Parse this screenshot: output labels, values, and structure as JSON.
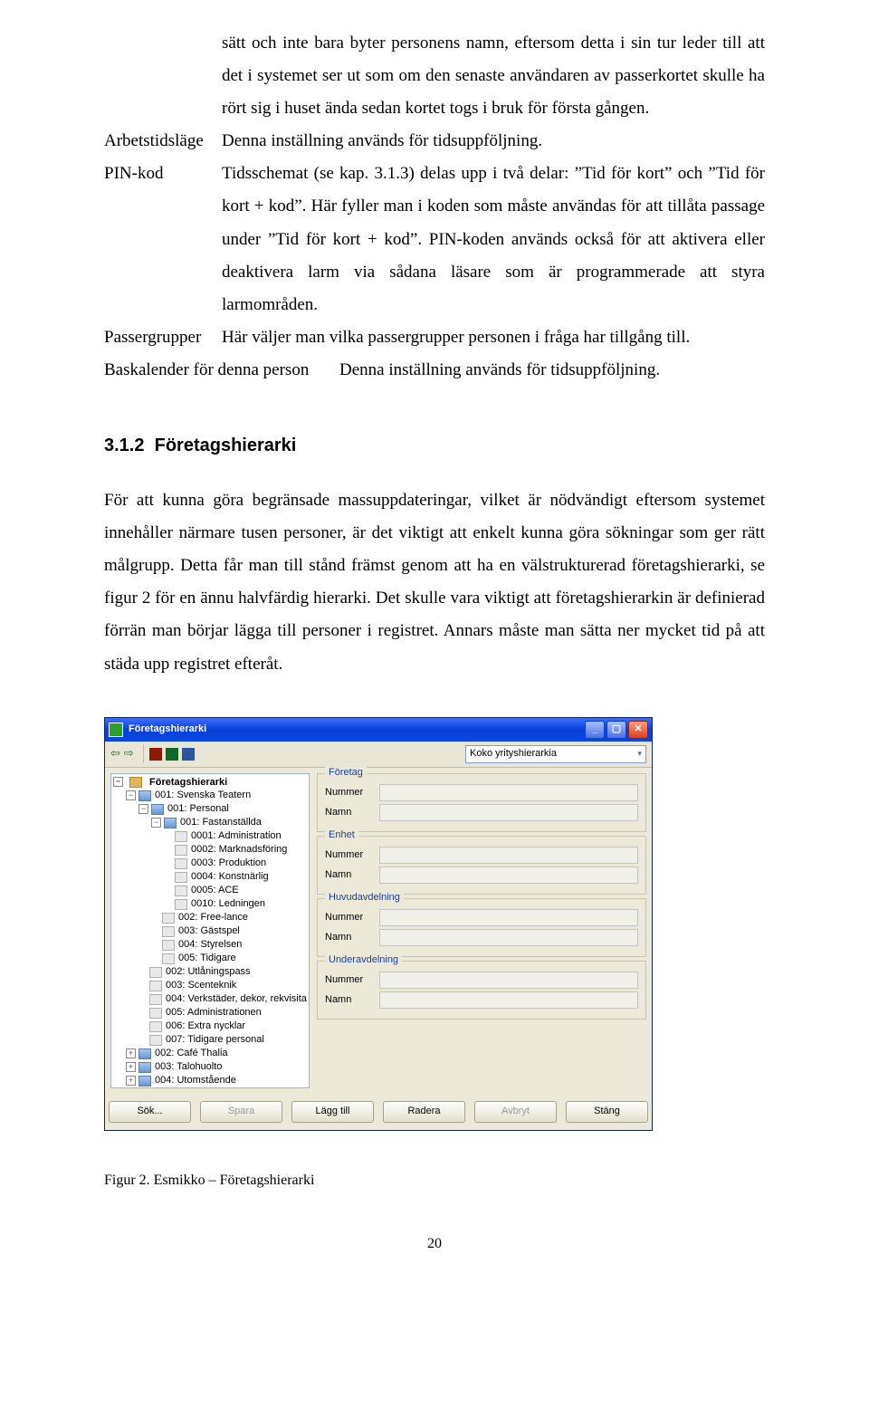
{
  "defs": {
    "intro_cont": "sätt och inte bara byter personens namn, eftersom detta i sin tur leder till att det i systemet ser ut som om den senaste användaren av passerkortet skulle ha rört sig i huset ända sedan kortet togs i bruk för första gången.",
    "arbetstidslage": {
      "term": "Arbetstidsläge",
      "text": "Denna inställning används för tidsuppföljning."
    },
    "pin": {
      "term": "PIN-kod",
      "text": "Tidsschemat (se kap. 3.1.3) delas upp i två delar: ”Tid för kort” och ”Tid för kort + kod”. Här fyller man i koden som måste användas för att tillåta passage under ”Tid för kort + kod”. PIN-koden används också för att aktivera eller deaktivera larm via sådana läsare som är programmerade att styra larmområden."
    },
    "passergrupper": {
      "term": "Passergrupper",
      "text": "Här väljer man vilka passergrupper personen i fråga har tillgång till."
    },
    "baskalender": {
      "term": "Baskalender för denna person",
      "text": "Denna inställning används för tidsuppföljning."
    }
  },
  "section": {
    "num": "3.1.2",
    "title": "Företagshierarki"
  },
  "body": "För att kunna göra begränsade massuppdateringar, vilket är nödvändigt eftersom systemet innehåller närmare tusen personer, är det viktigt att enkelt kunna göra sökningar som ger rätt målgrupp. Detta får man till stånd främst genom att ha en välstrukturerad företagshierarki, se figur 2 för en ännu halvfärdig hierarki. Det skulle vara viktigt att företagshierarkin är definierad förrän man börjar lägga till personer i registret. Annars måste man sätta ner mycket tid på att städa upp registret efteråt.",
  "win": {
    "title": "Företagshierarki",
    "combo": "Koko yrityshierarkia",
    "root": "Företagshierarki",
    "tree": [
      {
        "d": 1,
        "t": "−",
        "i": "f",
        "l": "001: Svenska Teatern"
      },
      {
        "d": 2,
        "t": "−",
        "i": "f",
        "l": "001: Personal"
      },
      {
        "d": 3,
        "t": "−",
        "i": "f",
        "l": "001: Fastanställda"
      },
      {
        "d": 4,
        "t": "",
        "i": "l",
        "l": "0001: Administration"
      },
      {
        "d": 4,
        "t": "",
        "i": "l",
        "l": "0002: Marknadsföring"
      },
      {
        "d": 4,
        "t": "",
        "i": "l",
        "l": "0003: Produktion"
      },
      {
        "d": 4,
        "t": "",
        "i": "l",
        "l": "0004: Konstnärlig"
      },
      {
        "d": 4,
        "t": "",
        "i": "l",
        "l": "0005: ACE"
      },
      {
        "d": 4,
        "t": "",
        "i": "l",
        "l": "0010: Ledningen"
      },
      {
        "d": 3,
        "t": "",
        "i": "l",
        "l": "002: Free-lance"
      },
      {
        "d": 3,
        "t": "",
        "i": "l",
        "l": "003: Gästspel"
      },
      {
        "d": 3,
        "t": "",
        "i": "l",
        "l": "004: Styrelsen"
      },
      {
        "d": 3,
        "t": "",
        "i": "l",
        "l": "005: Tidigare"
      },
      {
        "d": 2,
        "t": "",
        "i": "l",
        "l": "002: Utlåningspass"
      },
      {
        "d": 2,
        "t": "",
        "i": "l",
        "l": "003: Scenteknik"
      },
      {
        "d": 2,
        "t": "",
        "i": "l",
        "l": "004: Verkstäder, dekor, rekvisita"
      },
      {
        "d": 2,
        "t": "",
        "i": "l",
        "l": "005: Administrationen"
      },
      {
        "d": 2,
        "t": "",
        "i": "l",
        "l": "006: Extra nycklar"
      },
      {
        "d": 2,
        "t": "",
        "i": "l",
        "l": "007: Tidigare personal"
      },
      {
        "d": 1,
        "t": "+",
        "i": "f",
        "l": "002: Café Thalia"
      },
      {
        "d": 1,
        "t": "+",
        "i": "f",
        "l": "003: Talohuolto"
      },
      {
        "d": 1,
        "t": "+",
        "i": "f",
        "l": "004: Utomstående"
      }
    ],
    "groups": [
      {
        "legend": "Företag",
        "fields": [
          "Nummer",
          "Namn"
        ]
      },
      {
        "legend": "Enhet",
        "fields": [
          "Nummer",
          "Namn"
        ]
      },
      {
        "legend": "Huvudavdelning",
        "fields": [
          "Nummer",
          "Namn"
        ]
      },
      {
        "legend": "Underavdelning",
        "fields": [
          "Nummer",
          "Namn"
        ]
      }
    ],
    "buttons": [
      {
        "l": "Sök...",
        "cls": ""
      },
      {
        "l": "Spara",
        "cls": "disabled"
      },
      {
        "l": "Lägg till",
        "cls": ""
      },
      {
        "l": "Radera",
        "cls": ""
      },
      {
        "l": "Avbryt",
        "cls": "disabled"
      },
      {
        "l": "Stäng",
        "cls": ""
      }
    ]
  },
  "caption": "Figur 2. Esmikko – Företagshierarki",
  "pagenum": "20"
}
